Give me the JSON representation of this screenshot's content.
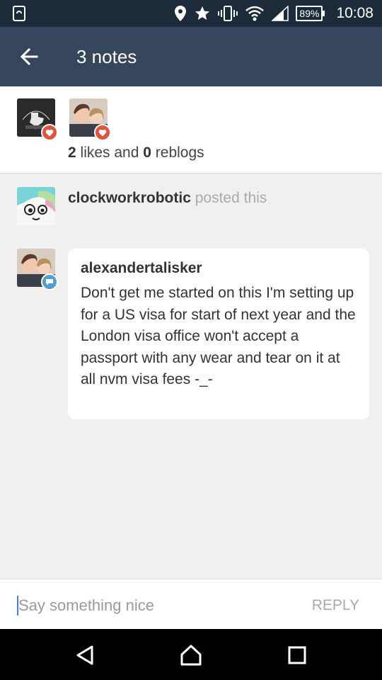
{
  "status_bar": {
    "battery": "89%",
    "time": "10:08"
  },
  "header": {
    "title": "3 notes"
  },
  "likes": {
    "likes_count": "2",
    "likes_word": " likes and ",
    "reblogs_count": "0",
    "reblogs_word": " reblogs"
  },
  "posted": {
    "username": "clockworkrobotic",
    "suffix": " posted this"
  },
  "comment": {
    "username": "alexandertalisker",
    "text": "Don't get me started on this I'm setting up for a US visa for start of next year and the London visa office won't accept a passport with any wear and tear on it at all nvm visa fees -_-"
  },
  "reply": {
    "placeholder": "Say something nice",
    "button": "REPLY"
  },
  "colors": {
    "header": "#36465d",
    "status_bar": "#1c2a3a",
    "heart_badge": "#e0533e",
    "chat_badge": "#529ecc"
  }
}
